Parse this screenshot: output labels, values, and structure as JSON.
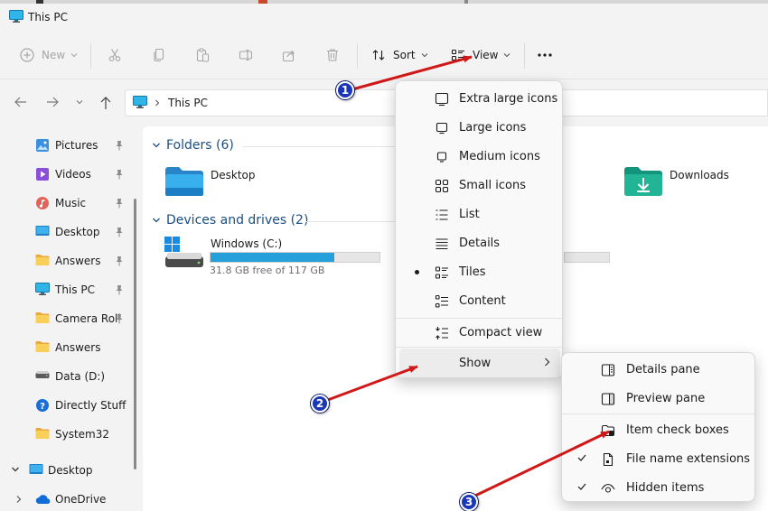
{
  "window": {
    "title": "This PC"
  },
  "toolbar": {
    "new_label": "New",
    "sort_label": "Sort",
    "view_label": "View"
  },
  "address": {
    "path": "This PC"
  },
  "sidebar": {
    "items": [
      {
        "label": "Pictures",
        "icon": "pictures-icon"
      },
      {
        "label": "Videos",
        "icon": "videos-icon"
      },
      {
        "label": "Music",
        "icon": "music-icon"
      },
      {
        "label": "Desktop",
        "icon": "desktop-icon"
      },
      {
        "label": "Answers",
        "icon": "folder-icon"
      },
      {
        "label": "This PC",
        "icon": "this-pc-icon"
      },
      {
        "label": "Camera Roll",
        "icon": "folder-icon"
      },
      {
        "label": "Answers",
        "icon": "folder-icon"
      },
      {
        "label": "Data (D:)",
        "icon": "drive-icon"
      },
      {
        "label": "Directly Stuff",
        "icon": "help-icon"
      },
      {
        "label": "System32",
        "icon": "folder-icon"
      },
      {
        "label": "Desktop",
        "icon": "desktop-icon"
      },
      {
        "label": "OneDrive",
        "icon": "onedrive-icon"
      }
    ]
  },
  "content": {
    "folders_header": "Folders (6)",
    "devices_header": "Devices and drives (2)",
    "folders": [
      {
        "name": "Desktop"
      },
      {
        "name": "Downloads"
      }
    ],
    "drive": {
      "name": "Windows (C:)",
      "free": "31.8 GB free of 117 GB",
      "used_fraction": 0.73
    }
  },
  "view_menu": {
    "items": [
      {
        "label": "Extra large icons"
      },
      {
        "label": "Large icons"
      },
      {
        "label": "Medium icons"
      },
      {
        "label": "Small icons"
      },
      {
        "label": "List"
      },
      {
        "label": "Details"
      },
      {
        "label": "Tiles",
        "selected": true
      },
      {
        "label": "Content"
      },
      {
        "label": "Compact view"
      },
      {
        "label": "Show"
      }
    ]
  },
  "show_menu": {
    "items": [
      {
        "label": "Details pane"
      },
      {
        "label": "Preview pane"
      },
      {
        "label": "Item check boxes",
        "checked": false
      },
      {
        "label": "File name extensions",
        "checked": true
      },
      {
        "label": "Hidden items",
        "checked": true
      }
    ]
  },
  "annotations": {
    "badges": [
      "1",
      "2",
      "3"
    ],
    "arrow_color": "#d01818",
    "badge_color": "#1a37b8"
  },
  "colors": {
    "accent": "#26a0da",
    "folder_yellow": "#f4c542",
    "group_header": "#1c4e80"
  }
}
